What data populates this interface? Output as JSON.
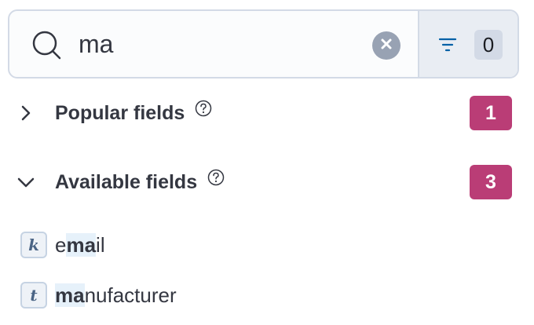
{
  "search": {
    "value": "ma",
    "filter_count": "0"
  },
  "sections": [
    {
      "title": "Popular fields",
      "count": "1",
      "expanded": false
    },
    {
      "title": "Available fields",
      "count": "3",
      "expanded": true
    }
  ],
  "fields": [
    {
      "type": "k",
      "pre": "e",
      "match": "ma",
      "post": "il"
    },
    {
      "type": "t",
      "pre": "",
      "match": "ma",
      "post": "nufacturer"
    }
  ],
  "colors": {
    "badge": "#ba3d76",
    "filter_bg": "#e9edf3",
    "highlight": "#e6f1fa"
  }
}
